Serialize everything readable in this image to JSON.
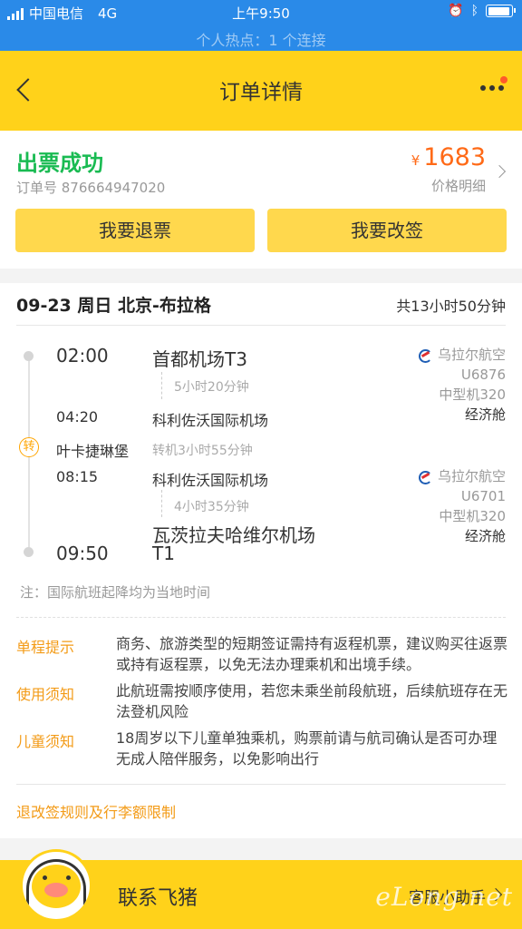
{
  "status_bar": {
    "carrier": "中国电信",
    "network": "4G",
    "time": "上午9:50",
    "hotspot": "个人热点：1 个连接",
    "battery_level": 0.95
  },
  "nav": {
    "title": "订单详情"
  },
  "order": {
    "status": "出票成功",
    "order_no": "订单号 876664947020",
    "currency": "¥",
    "price": "1683",
    "price_detail": "价格明细",
    "refund_button": "我要退票",
    "change_button": "我要改签"
  },
  "flight": {
    "route": "09-23 周日 北京-布拉格",
    "total_duration": "共13小时50分钟",
    "transfer_icon": "转",
    "transfer_city": "叶卡捷琳堡",
    "transfer_time": "转机3小时55分钟",
    "segments": [
      {
        "dep_time": "02:00",
        "dep_airport": "首都机场T3",
        "duration": "5小时20分钟",
        "arr_time": "04:20",
        "arr_airport": "科利佐沃国际机场",
        "airline": "乌拉尔航空",
        "flight_no": "U6876",
        "aircraft": "中型机320",
        "cabin": "经济舱"
      },
      {
        "dep_time": "08:15",
        "dep_airport": "科利佐沃国际机场",
        "duration": "4小时35分钟",
        "arr_time": "09:50",
        "arr_airport_line1": "瓦茨拉夫哈维尔机场",
        "arr_airport_line2": "T1",
        "airline": "乌拉尔航空",
        "flight_no": "U6701",
        "aircraft": "中型机320",
        "cabin": "经济舱"
      }
    ],
    "note": "注：国际航班起降均为当地时间"
  },
  "tips": [
    {
      "label": "单程提示",
      "text": "商务、旅游类型的短期签证需持有返程机票，建议购买往返票或持有返程票，以免无法办理乘机和出境手续。"
    },
    {
      "label": "使用须知",
      "text": "此航班需按顺序使用，若您未乘坐前段航班，后续航班存在无法登机风险"
    },
    {
      "label": "儿童须知",
      "text": "18周岁以下儿童单独乘机，购票前请与航司确认是否可办理无成人陪伴服务，以免影响出行"
    }
  ],
  "rules_link": "退改签规则及行李额限制",
  "bottom": {
    "contact": "联系飞猪",
    "assistant": "客服小助手",
    "watermark": "eLong.net"
  },
  "colors": {
    "status_bar": "#2a8ae8",
    "brand_yellow": "#ffd21a",
    "success_green": "#19bb52",
    "price_orange": "#ff6a17",
    "tip_orange": "#f39b17"
  }
}
